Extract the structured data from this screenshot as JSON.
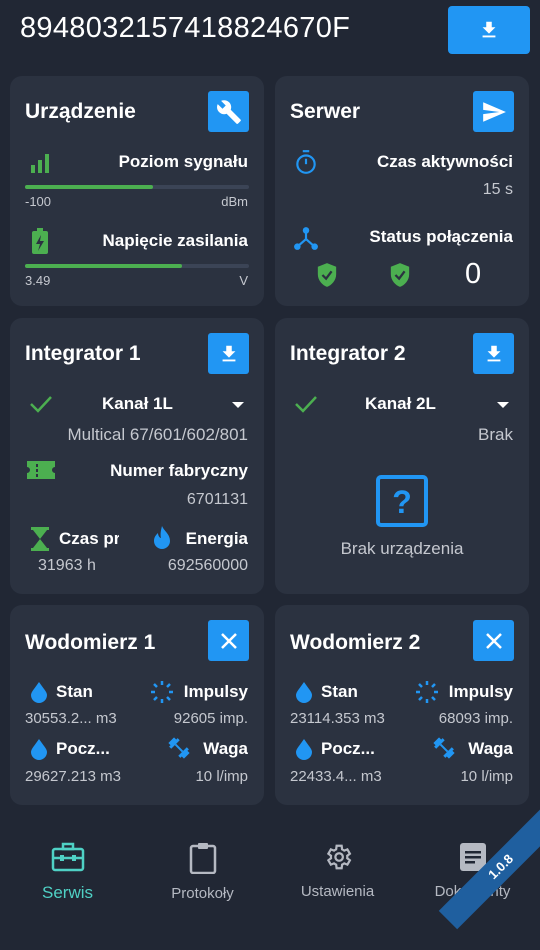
{
  "device": {
    "id": "89480321574188246​70F"
  },
  "urzadzenie": {
    "title": "Urządzenie",
    "signal_label": "Poziom sygnału",
    "signal_min": "-100",
    "signal_unit": "dBm",
    "signal_level": 0.57,
    "voltage_label": "Napięcie zasilania",
    "voltage_value": "3.49",
    "voltage_unit": "V",
    "voltage_level": 0.7
  },
  "serwer": {
    "title": "Serwer",
    "uptime_label": "Czas aktywności",
    "uptime_value": "15 s",
    "status_label": "Status połączenia",
    "status_count": "0"
  },
  "integrator1": {
    "title": "Integrator 1",
    "channel": "Kanał 1L",
    "device_name": "Multical 67/601/602/801",
    "serial_label": "Numer fabryczny",
    "serial_value": "6701131",
    "time_label": "Czas pracy",
    "time_value": "31963 h",
    "energy_label": "Energia",
    "energy_value": "692560000"
  },
  "integrator2": {
    "title": "Integrator 2",
    "channel": "Kanał 2L",
    "status": "Brak",
    "no_device": "Brak urządzenia"
  },
  "wodomierz1": {
    "title": "Wodomierz 1",
    "stan_label": "Stan",
    "stan_value": "30553.2... m3",
    "impulsy_label": "Impulsy",
    "impulsy_value": "92605 imp.",
    "pocz_label": "Pocz...",
    "pocz_value": "29627.213 m3",
    "waga_label": "Waga",
    "waga_value": "10 l/imp"
  },
  "wodomierz2": {
    "title": "Wodomierz 2",
    "stan_label": "Stan",
    "stan_value": "23114.353 m3",
    "impulsy_label": "Impulsy",
    "impulsy_value": "68093 imp.",
    "pocz_label": "Pocz...",
    "pocz_value": "22433.4... m3",
    "waga_label": "Waga",
    "waga_value": "10 l/imp"
  },
  "nav": {
    "serwis": "Serwis",
    "protokoly": "Protokoły",
    "ustawienia": "Ustawienia",
    "dokumenty": "Dokumenty"
  },
  "version": "1.0.8",
  "colors": {
    "accent": "#2196f3",
    "ok": "#4caf50",
    "active_nav": "#4fd1c5",
    "card": "#2b3240",
    "bg": "#212734"
  }
}
